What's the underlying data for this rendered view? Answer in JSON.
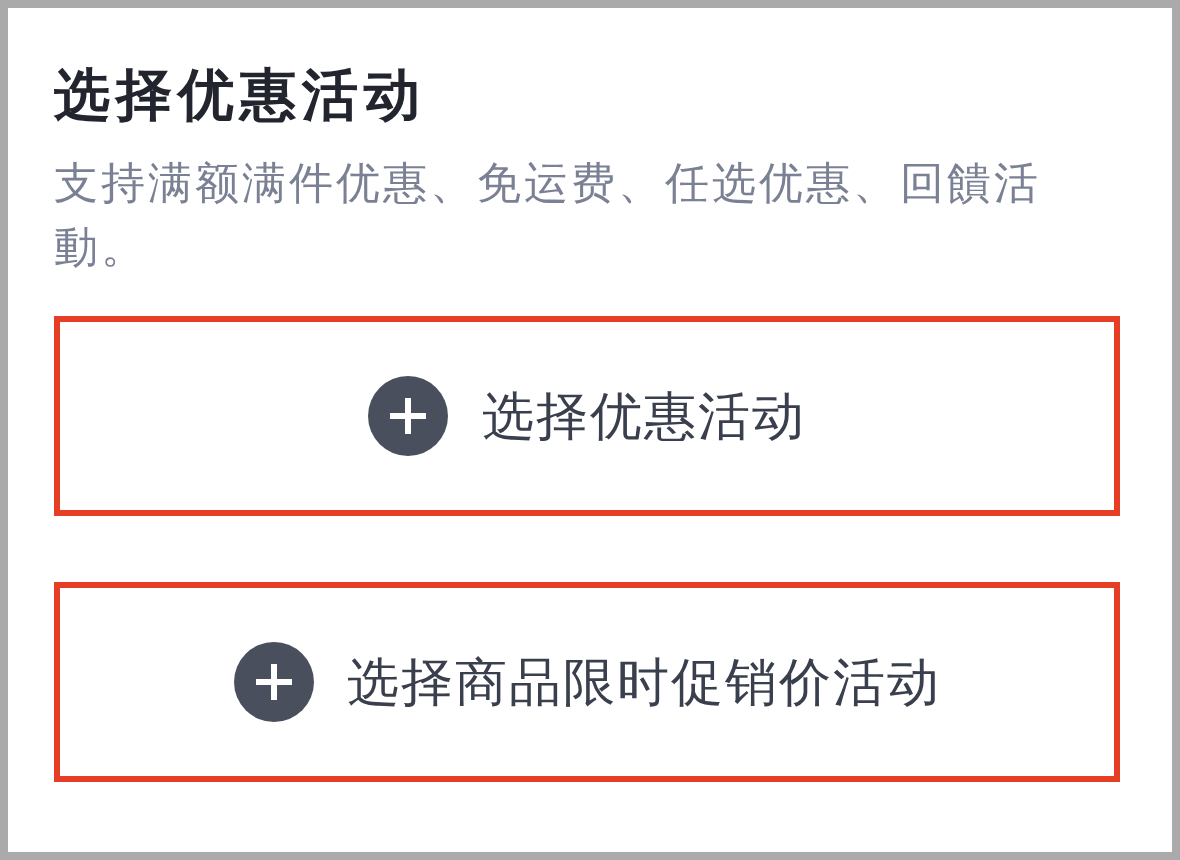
{
  "title": "选择优惠活动",
  "description": "支持满额满件优惠、免运费、任选优惠、回饋活動。",
  "buttons": [
    {
      "label": "选择优惠活动"
    },
    {
      "label": "选择商品限时促销价活动"
    }
  ]
}
